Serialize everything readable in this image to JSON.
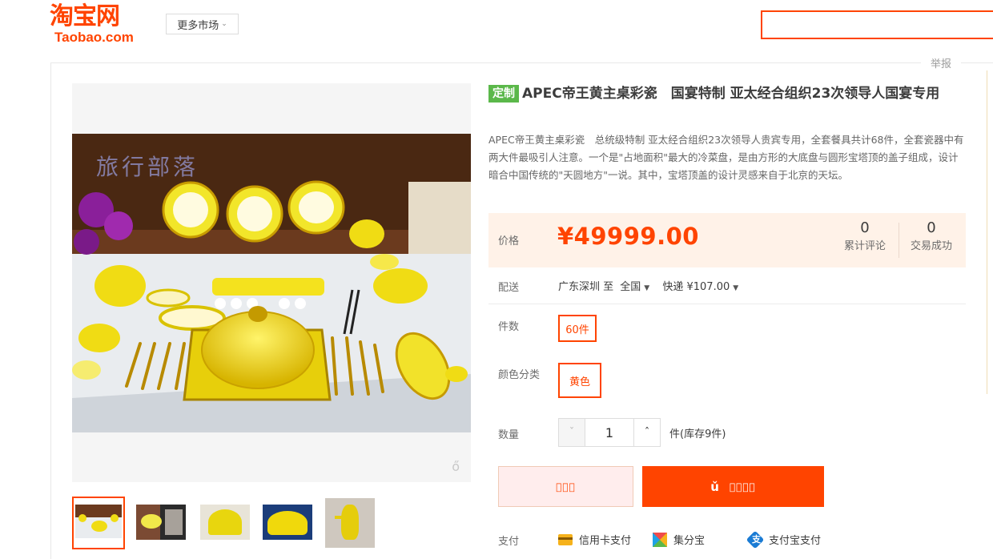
{
  "header": {
    "logo_cn": "淘宝网",
    "logo_en": "Taobao.com",
    "market_label": "更多市场",
    "search_placeholder": ""
  },
  "report_label": "举报",
  "product": {
    "tag": "定制",
    "title": "APEC帝王黄主桌彩瓷　国宴特制 亚太经合组织23次领导人国宴专用",
    "description": "APEC帝王黄主桌彩瓷　总统级特制 亚太经合组织23次领导人贵宾专用，全套餐具共计68件，全套瓷器中有两大件最吸引人注意。一个是\"占地面积\"最大的冷菜盘，是由方形的大底盘与圆形宝塔顶的盖子组成，设计暗合中国传统的\"天圆地方\"一说。其中，宝塔顶盖的设计灵感来自于北京的天坛。",
    "watermark": "旅行部落"
  },
  "price": {
    "label": "价格",
    "value": "¥49999.00",
    "reviews_count": "0",
    "reviews_label": "累计评论",
    "sales_count": "0",
    "sales_label": "交易成功"
  },
  "shipping": {
    "label": "配送",
    "from": "广东深圳 至",
    "to": "全国",
    "method": "快递 ¥107.00"
  },
  "options": {
    "count_label": "件数",
    "count_value": "60件",
    "color_label": "颜色分类",
    "color_value": "黄色"
  },
  "quantity": {
    "label": "数量",
    "dec": "ˇ",
    "value": "1",
    "inc": "ˆ",
    "stock": "件(库存9件)"
  },
  "buttons": {
    "buy_label": "",
    "cart_icon": "ǔ",
    "cart_label": ""
  },
  "payment": {
    "label": "支付",
    "methods": [
      "信用卡支付",
      "集分宝",
      "支付宝支付"
    ]
  },
  "colors": {
    "brand": "#ff4400",
    "tag_green": "#5bb84a",
    "price_bg": "#fff2e8"
  }
}
